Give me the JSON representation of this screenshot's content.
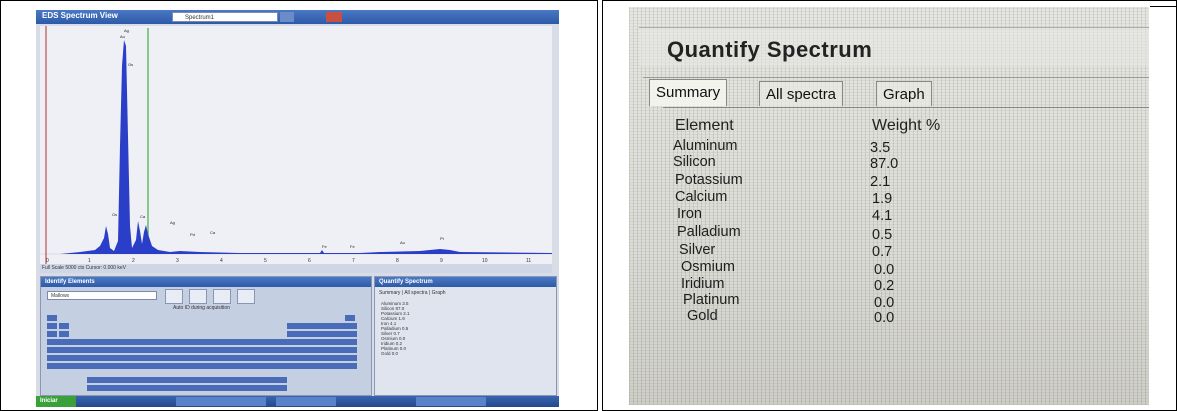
{
  "left_screen": {
    "window_title": "EDS Spectrum View",
    "spectrum_select": "Spectrum1",
    "status_text": "Full Scale 5000 cts Cursor: 0.000 keV",
    "identify_panel": {
      "title": "Identify Elements",
      "filter_select": "Mallows",
      "auto_id_label": "Auto ID during acquisition"
    },
    "quantify_small": {
      "title": "Quantify Spectrum",
      "tabs": [
        "Summary",
        "All spectra",
        "Graph"
      ]
    },
    "taskbar": {
      "start_label": "Iniciar"
    }
  },
  "right_screen": {
    "title": "Quantify Spectrum",
    "tabs": [
      {
        "label": "Summary",
        "active": true
      },
      {
        "label": "All spectra",
        "active": false
      },
      {
        "label": "Graph",
        "active": false
      }
    ],
    "table": {
      "headers": [
        "Element",
        "Weight %"
      ],
      "rows": [
        {
          "element": "Aluminum",
          "weight": "3.5"
        },
        {
          "element": "Silicon",
          "weight": "87.0"
        },
        {
          "element": "Potassium",
          "weight": "2.1"
        },
        {
          "element": "Calcium",
          "weight": "1.9"
        },
        {
          "element": "Iron",
          "weight": "4.1"
        },
        {
          "element": "Palladium",
          "weight": "0.5"
        },
        {
          "element": "Silver",
          "weight": "0.7"
        },
        {
          "element": "Osmium",
          "weight": "0.0"
        },
        {
          "element": "Iridium",
          "weight": "0.2"
        },
        {
          "element": "Platinum",
          "weight": "0.0"
        },
        {
          "element": "Gold",
          "weight": "0.0"
        }
      ]
    }
  }
}
